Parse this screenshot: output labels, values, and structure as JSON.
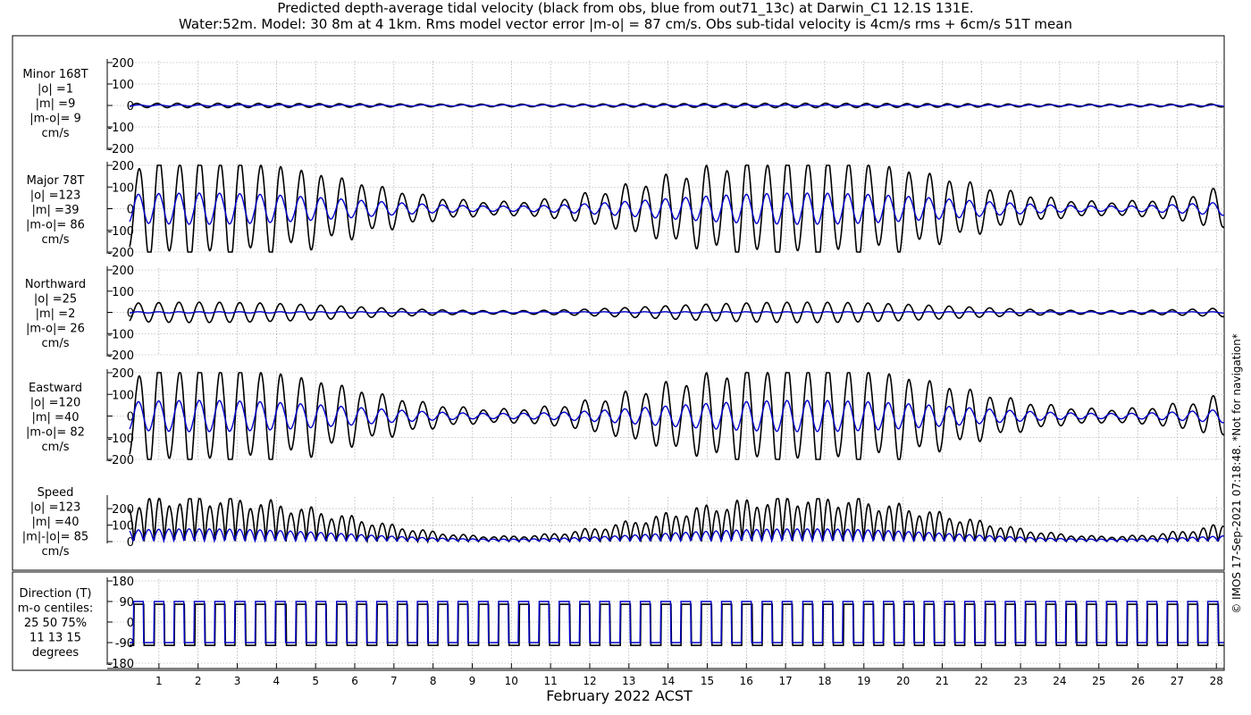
{
  "title": "Predicted depth-average tidal velocity (black from obs, blue from out71_13c) at Darwin_C1 12.1S 131E.",
  "subtitle": "Water:52m. Model: 30 8m at 4 1km. Rms model vector error |m-o| = 87 cm/s. Obs sub-tidal velocity is 4cm/s rms + 6cm/s 51T mean",
  "copyright": "© IMOS 17-Sep-2021 07:18:48. *Not for navigation*",
  "xlabel": "February 2022 ACST",
  "colors": {
    "obs": "#000000",
    "model": "#0000cc",
    "grid": "#9a9a9a"
  },
  "chart_data": [
    {
      "type": "line",
      "panel": "minor",
      "labels": [
        "Minor 168T",
        "|o| =1",
        "|m| =9",
        "|m-o|= 9",
        "cm/s"
      ],
      "yticks": [
        200,
        100,
        0,
        -100,
        -200
      ],
      "ylim": [
        -200,
        200
      ],
      "x": {
        "ticks": [
          1,
          2,
          3,
          4,
          5,
          6,
          7,
          8,
          9,
          10,
          11,
          12,
          13,
          14,
          15,
          16,
          17,
          18,
          19,
          20,
          21,
          22,
          23,
          24,
          25,
          26,
          27,
          28
        ],
        "range_days": [
          0.25,
          28.2
        ]
      },
      "series": [
        {
          "name": "obs",
          "amplitude": 12,
          "mean": 0
        },
        {
          "name": "model",
          "amplitude": 4,
          "mean": 0
        }
      ]
    },
    {
      "type": "line",
      "panel": "major",
      "labels": [
        "Major 78T",
        "|o| =123",
        "|m| =39",
        "|m-o|= 86",
        "cm/s"
      ],
      "yticks": [
        200,
        100,
        0,
        -100,
        -200
      ],
      "ylim": [
        -200,
        200
      ],
      "series": [
        {
          "name": "obs",
          "amplitude_range": [
            25,
            240
          ]
        },
        {
          "name": "model",
          "amplitude_range": [
            10,
            75
          ]
        }
      ]
    },
    {
      "type": "line",
      "panel": "northward",
      "labels": [
        "Northward",
        "|o| =25",
        "|m| =2",
        "|m-o|= 26",
        "cm/s"
      ],
      "yticks": [
        200,
        100,
        0,
        -100,
        -200
      ],
      "ylim": [
        -200,
        200
      ],
      "series": [
        {
          "name": "obs",
          "amplitude_range": [
            5,
            50
          ]
        },
        {
          "name": "model",
          "amplitude_range": [
            0,
            5
          ]
        }
      ]
    },
    {
      "type": "line",
      "panel": "eastward",
      "labels": [
        "Eastward",
        "|o| =120",
        "|m| =40",
        "|m-o|= 82",
        "cm/s"
      ],
      "yticks": [
        200,
        100,
        0,
        -100,
        -200
      ],
      "ylim": [
        -200,
        200
      ],
      "series": [
        {
          "name": "obs",
          "amplitude_range": [
            25,
            240
          ]
        },
        {
          "name": "model",
          "amplitude_range": [
            10,
            75
          ]
        }
      ]
    },
    {
      "type": "line",
      "panel": "speed",
      "labels": [
        "Speed",
        "|o| =123",
        "|m| =40",
        "|m|-|o|= 85",
        "cm/s"
      ],
      "yticks": [
        200,
        100,
        0
      ],
      "ylim": [
        0,
        260
      ],
      "series": [
        {
          "name": "obs",
          "amplitude_range": [
            15,
            250
          ]
        },
        {
          "name": "model",
          "amplitude_range": [
            5,
            75
          ]
        }
      ]
    },
    {
      "type": "line",
      "panel": "direction",
      "labels": [
        "Direction (T)",
        "m-o centiles:",
        "25  50  75%",
        "11  13  15",
        "degrees"
      ],
      "yticks": [
        180,
        90,
        0,
        -90,
        -180
      ],
      "ylim": [
        -180,
        180
      ],
      "series": [
        {
          "name": "obs",
          "levels": [
            78,
            -102
          ]
        },
        {
          "name": "model",
          "levels": [
            90,
            -90
          ]
        }
      ]
    }
  ]
}
